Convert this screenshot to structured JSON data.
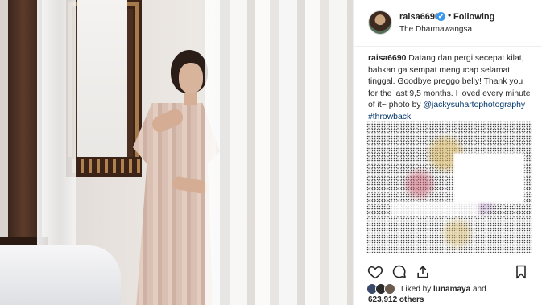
{
  "post": {
    "username": "raisa6690",
    "verified_badge": "✔",
    "separator": "•",
    "follow_status": "Following",
    "location": "The Dharmawangsa"
  },
  "caption": {
    "username": "raisa6690",
    "text": "Datang dan pergi secepat kilat, bahkan ga sempat mengucap selamat tinggal. Goodbye preggo belly! Thank you for the last 9,5 months. I loved every minute of it~ photo by",
    "mention": "@jackysuhartophotography",
    "hashtag": "#throwback"
  },
  "actions": {
    "icons": [
      "heart-icon",
      "comment-icon",
      "share-icon",
      "bookmark-icon"
    ]
  },
  "likes": {
    "prefix": "Liked by",
    "first_liker": "lunamaya",
    "conjunction": "and",
    "count_text": "623,912 others"
  },
  "colors": {
    "link": "#003569",
    "verified": "#3897f0",
    "text": "#262626",
    "border": "#efefef"
  }
}
